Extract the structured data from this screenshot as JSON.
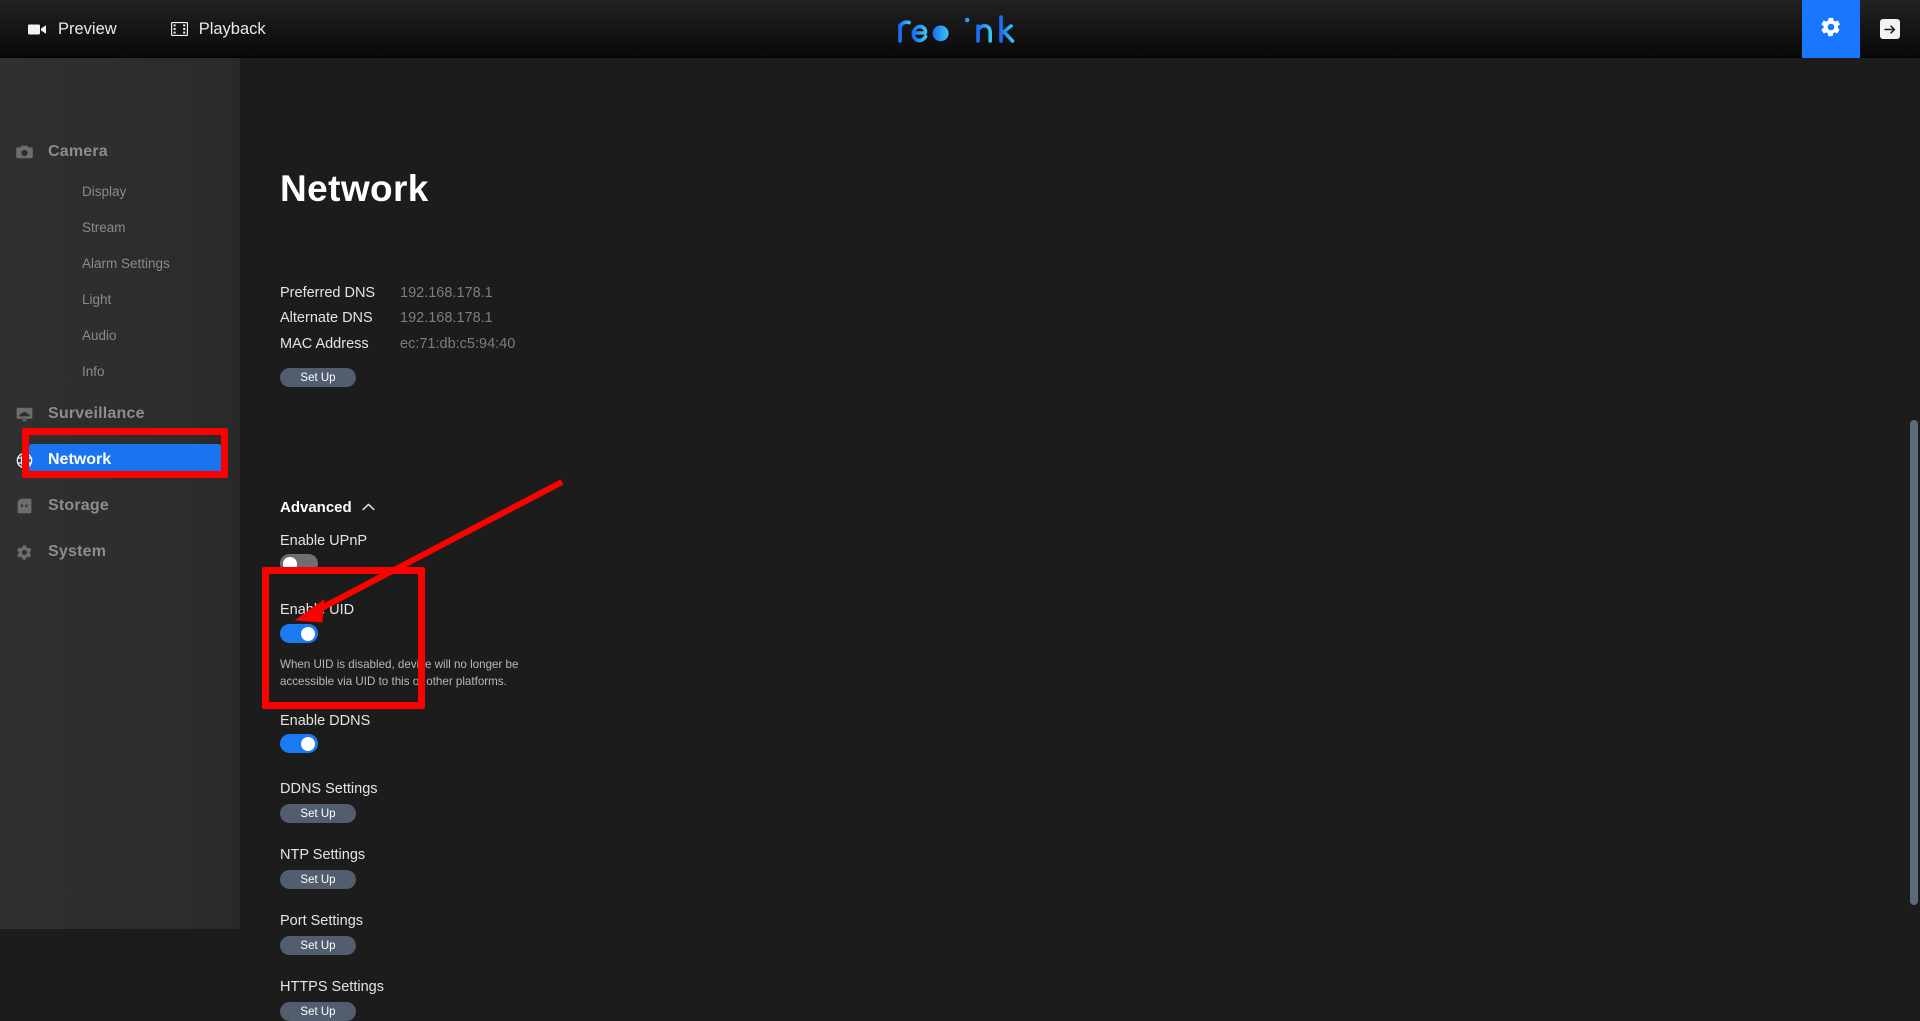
{
  "topbar": {
    "nav": [
      {
        "label": "Preview",
        "icon": "video-camera-icon"
      },
      {
        "label": "Playback",
        "icon": "film-strip-icon"
      }
    ],
    "logo_text": "reolink",
    "settings_icon": "gear-icon",
    "logout_icon": "exit-arrow-icon",
    "accent_blue": "#1976ff"
  },
  "sidebar": {
    "groups": [
      {
        "label": "Camera",
        "icon": "camera-icon",
        "children": [
          {
            "label": "Display"
          },
          {
            "label": "Stream"
          },
          {
            "label": "Alarm Settings"
          },
          {
            "label": "Light"
          },
          {
            "label": "Audio"
          },
          {
            "label": "Info"
          }
        ]
      },
      {
        "label": "Surveillance",
        "icon": "monitor-icon",
        "children": []
      },
      {
        "label": "Network",
        "icon": "globe-icon",
        "children": [],
        "active": true
      },
      {
        "label": "Storage",
        "icon": "sd-card-icon",
        "children": []
      },
      {
        "label": "System",
        "icon": "gear-icon",
        "children": []
      }
    ],
    "active_bg": "#1a73f0"
  },
  "main": {
    "title": "Network",
    "info": [
      {
        "key": "Preferred DNS",
        "value": "192.168.178.1"
      },
      {
        "key": "Alternate DNS",
        "value": "192.168.178.1"
      },
      {
        "key": "MAC Address",
        "value": "ec:71:db:c5:94:40"
      }
    ],
    "network_setup_button": "Set Up",
    "advanced": {
      "title": "Advanced",
      "collapse_icon": "chevron-up-icon",
      "upnp": {
        "label": "Enable UPnP",
        "state": "off"
      },
      "uid": {
        "label": "Enable UID",
        "state": "on",
        "hint": "When UID is disabled, device will no longer be accessible via UID to this or other platforms."
      },
      "ddns": {
        "label": "Enable DDNS",
        "state": "on"
      },
      "settings_rows": [
        {
          "label": "DDNS Settings",
          "button": "Set Up"
        },
        {
          "label": "NTP Settings",
          "button": "Set Up"
        },
        {
          "label": "Port Settings",
          "button": "Set Up"
        },
        {
          "label": "HTTPS Settings",
          "button": "Set Up"
        }
      ]
    }
  },
  "annotations": {
    "highlight_color": "#ff0000",
    "boxes": [
      {
        "name": "network-menu-highlight"
      },
      {
        "name": "ddns-section-highlight"
      }
    ],
    "arrow": {
      "name": "ddns-toggle-pointer"
    }
  }
}
